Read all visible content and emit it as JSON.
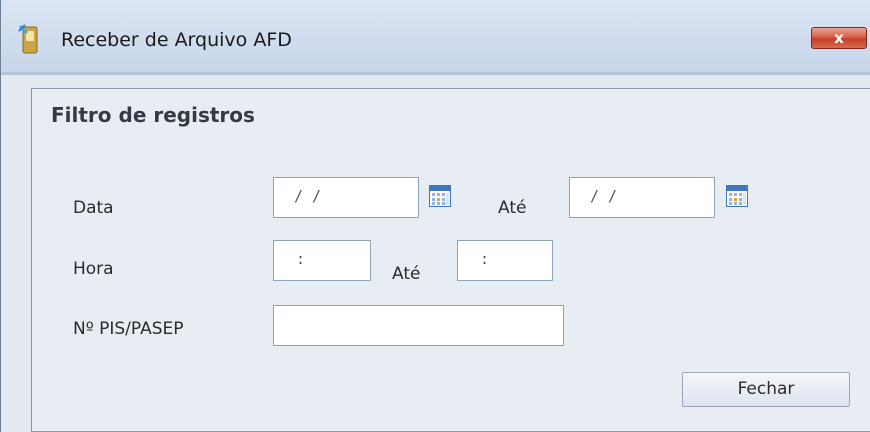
{
  "window": {
    "title": "Receber de Arquivo AFD",
    "close_label": "x"
  },
  "panel": {
    "title": "Filtro de registros"
  },
  "form": {
    "data_label": "Data",
    "data_from": "/ /",
    "data_until_label": "Até",
    "data_to": "/ /",
    "hora_label": "Hora",
    "hora_from": ":",
    "hora_until_label": "Até",
    "hora_to": ":",
    "pis_label": "Nº PIS/PASEP",
    "pis_value": ""
  },
  "buttons": {
    "fechar": "Fechar"
  },
  "colors": {
    "window_bg": "#e3e9f1",
    "titlebar": "#c8d6ea",
    "close_button": "#c63f28",
    "input_border": "#8ea3bf"
  }
}
